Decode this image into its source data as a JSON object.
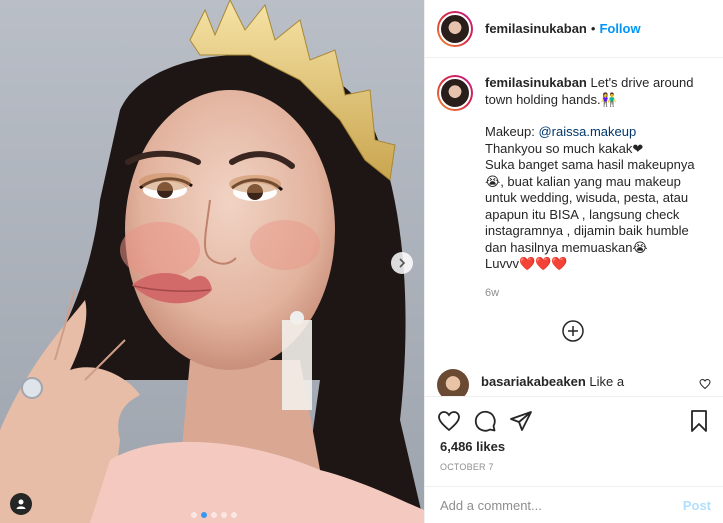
{
  "post": {
    "username": "femilasinukaban",
    "separator": "•",
    "follow_label": "Follow",
    "caption_lines": [
      "Let's drive around town holding hands.👫",
      "",
      "Makeup: ",
      "Thankyou so much kakak❤",
      "Suka banget sama hasil makeupnya 😭, buat kalian yang mau makeup untuk wedding, wisuda, pesta, atau apapun itu BISA , langsung check instagramnya , dijamin baik humble dan hasilnya memuaskan😭",
      "Luvvv❤️❤️❤️"
    ],
    "caption_first": "Let's drive around town holding hands.👫",
    "makeup_label": "Makeup: ",
    "makeup_mention": "@raissa.makeup",
    "line_thanks": "Thankyou so much kakak❤",
    "line_body": "Suka banget sama hasil makeupnya 😭, buat kalian yang mau makeup untuk wedding, wisuda, pesta, atau apapun itu BISA , langsung check instagramnya , dijamin baik humble dan hasilnya memuaskan😭",
    "line_luv": "Luvvv❤️❤️❤️",
    "caption_age": "6w",
    "likes": "6,486 likes",
    "date": "OCTOBER 7"
  },
  "comment": {
    "username": "basariakabeaken",
    "text": "Like a"
  },
  "composer": {
    "placeholder": "Add a comment...",
    "post_label": "Post"
  },
  "carousel": {
    "count": 5,
    "active_index": 1
  },
  "icons": {
    "like": "heart-icon",
    "comment": "comment-bubble-icon",
    "share": "paper-plane-icon",
    "save": "bookmark-icon",
    "next": "chevron-right-icon",
    "tag": "user-tag-icon",
    "load_more": "plus-circle-icon"
  },
  "colors": {
    "follow": "#0095f6",
    "post_disabled": "#b2dffc",
    "carousel_active": "#3897f0",
    "muted": "#8e8e8e"
  }
}
